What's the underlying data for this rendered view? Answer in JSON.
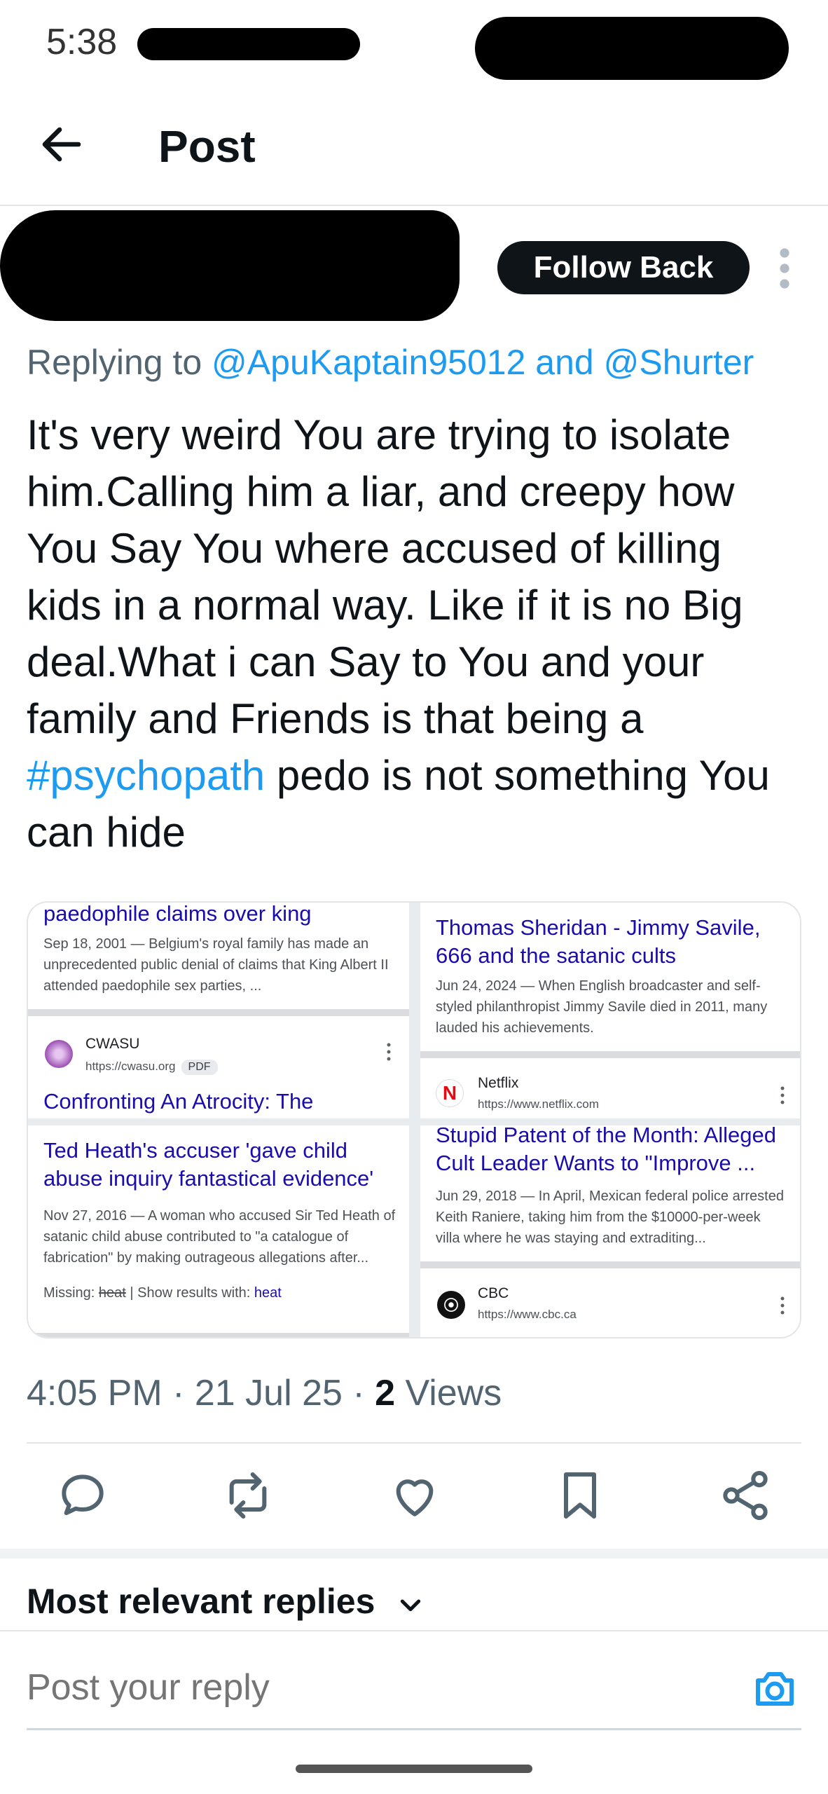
{
  "status_bar": {
    "time": "5:38"
  },
  "header": {
    "title": "Post",
    "back_icon": "arrow-left-icon"
  },
  "author": {
    "follow_label": "Follow Back"
  },
  "reply_context": {
    "prefix": "Replying to ",
    "mention_1": "@ApuKaptain95012",
    "joiner": " and ",
    "mention_2": "@Shurter"
  },
  "tweet": {
    "text_before": "It's very weird You are trying to isolate him.Calling him a liar, and creepy how You Say You where accused of killing kids in a normal way. Like if it is no Big deal.What i can Say to You and your family and Friends is that being a ",
    "hashtag": "#psychopath",
    "text_after": " pedo is not something You can hide"
  },
  "media": {
    "top_left": {
      "title": "paedophile claims over king",
      "snippet": "Sep 18, 2001 — Belgium's royal family has made an unprecedented public denial of claims that King Albert II attended paedophile sex parties, ...",
      "source": "CWASU",
      "url": "https://cwasu.org",
      "badge": "PDF",
      "next_title": "Confronting An Atrocity: The"
    },
    "top_right": {
      "title": "Thomas Sheridan - Jimmy Savile, 666 and the satanic cults",
      "snippet": "Jun 24, 2024 — When English broadcaster and self-styled philanthropist Jimmy Savile died in 2011, many lauded his achievements.",
      "source": "Netflix",
      "url": "https://www.netflix.com",
      "favicon": "N"
    },
    "bottom_left": {
      "title": "Ted Heath's accuser 'gave child abuse inquiry fantastical evidence'",
      "snippet": "Nov 27, 2016 — A woman who accused Sir Ted Heath of satanic child abuse contributed to \"a catalogue of fabrication\" by making outrageous allegations after...",
      "missing_prefix": "Missing: ",
      "missing_word": "heat",
      "missing_mid": " | Show results with: ",
      "missing_link": "heat"
    },
    "bottom_right": {
      "title": "Stupid Patent of the Month: Alleged Cult Leader Wants to \"Improve ...",
      "snippet": "Jun 29, 2018 — In April, Mexican federal police arrested Keith Raniere, taking him from the $10000-per-week villa where he was staying and extraditing...",
      "source": "CBC",
      "url": "https://www.cbc.ca"
    }
  },
  "meta": {
    "time": "4:05 PM",
    "dot": " · ",
    "date": "21 Jul 25",
    "views_count": "2",
    "views_label": " Views"
  },
  "actions": [
    "reply-icon",
    "repost-icon",
    "like-icon",
    "bookmark-icon",
    "share-icon"
  ],
  "replies": {
    "sort_label": "Most relevant replies"
  },
  "composer": {
    "placeholder": "Post your reply"
  },
  "colors": {
    "accent": "#1d9bf0",
    "text": "#0f1419",
    "muted": "#536471"
  }
}
